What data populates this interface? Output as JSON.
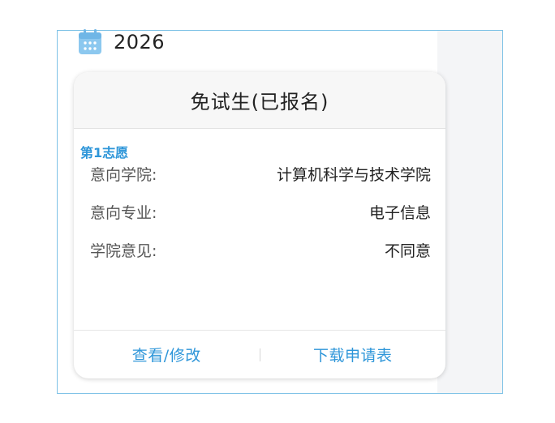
{
  "year": {
    "value": "2026",
    "icon": "calendar-icon"
  },
  "card": {
    "title": "免试生(已报名)",
    "choice_label": "第1志愿",
    "fields": [
      {
        "label": "意向学院:",
        "value": "计算机科学与技术学院"
      },
      {
        "label": "意向专业:",
        "value": "电子信息"
      },
      {
        "label": "学院意见:",
        "value": "不同意"
      }
    ],
    "actions": {
      "view_edit": "查看/修改",
      "download": "下载申请表"
    }
  },
  "colors": {
    "accent": "#2e96d9",
    "frame_border": "#7ec2e6",
    "calendar_icon": "#8cc8ef"
  }
}
